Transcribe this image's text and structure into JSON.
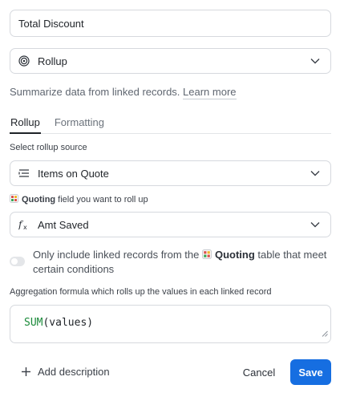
{
  "field_name": {
    "value": "Total Discount"
  },
  "field_type": {
    "value": "Rollup",
    "icon": "rollup-icon"
  },
  "helper": {
    "text": "Summarize data from linked records. ",
    "link": "Learn more"
  },
  "tabs": [
    {
      "label": "Rollup",
      "active": true
    },
    {
      "label": "Formatting",
      "active": false
    }
  ],
  "rollup_source": {
    "label": "Select rollup source",
    "value": "Items on Quote",
    "icon": "linked-records-icon"
  },
  "rollup_field": {
    "label_bold": "Quoting",
    "label_rest": "field you want to roll up",
    "value": "Amt Saved",
    "icon": "formula-fx-icon"
  },
  "condition_toggle": {
    "enabled": false,
    "text_before": "Only include linked records from the ",
    "table_name": "Quoting",
    "text_after": " table that meet certain conditions"
  },
  "aggregation": {
    "label": "Aggregation formula which rolls up the values in each linked record",
    "function": "SUM",
    "args": "(values)"
  },
  "footer": {
    "add_description": "Add description",
    "cancel": "Cancel",
    "save": "Save"
  },
  "colors": {
    "primary": "#166ee1",
    "formula_fn": "#1b8a3a",
    "table_icon_red": "#d9534f",
    "table_icon_green": "#3aa757",
    "table_icon_yellow": "#f0b429"
  }
}
